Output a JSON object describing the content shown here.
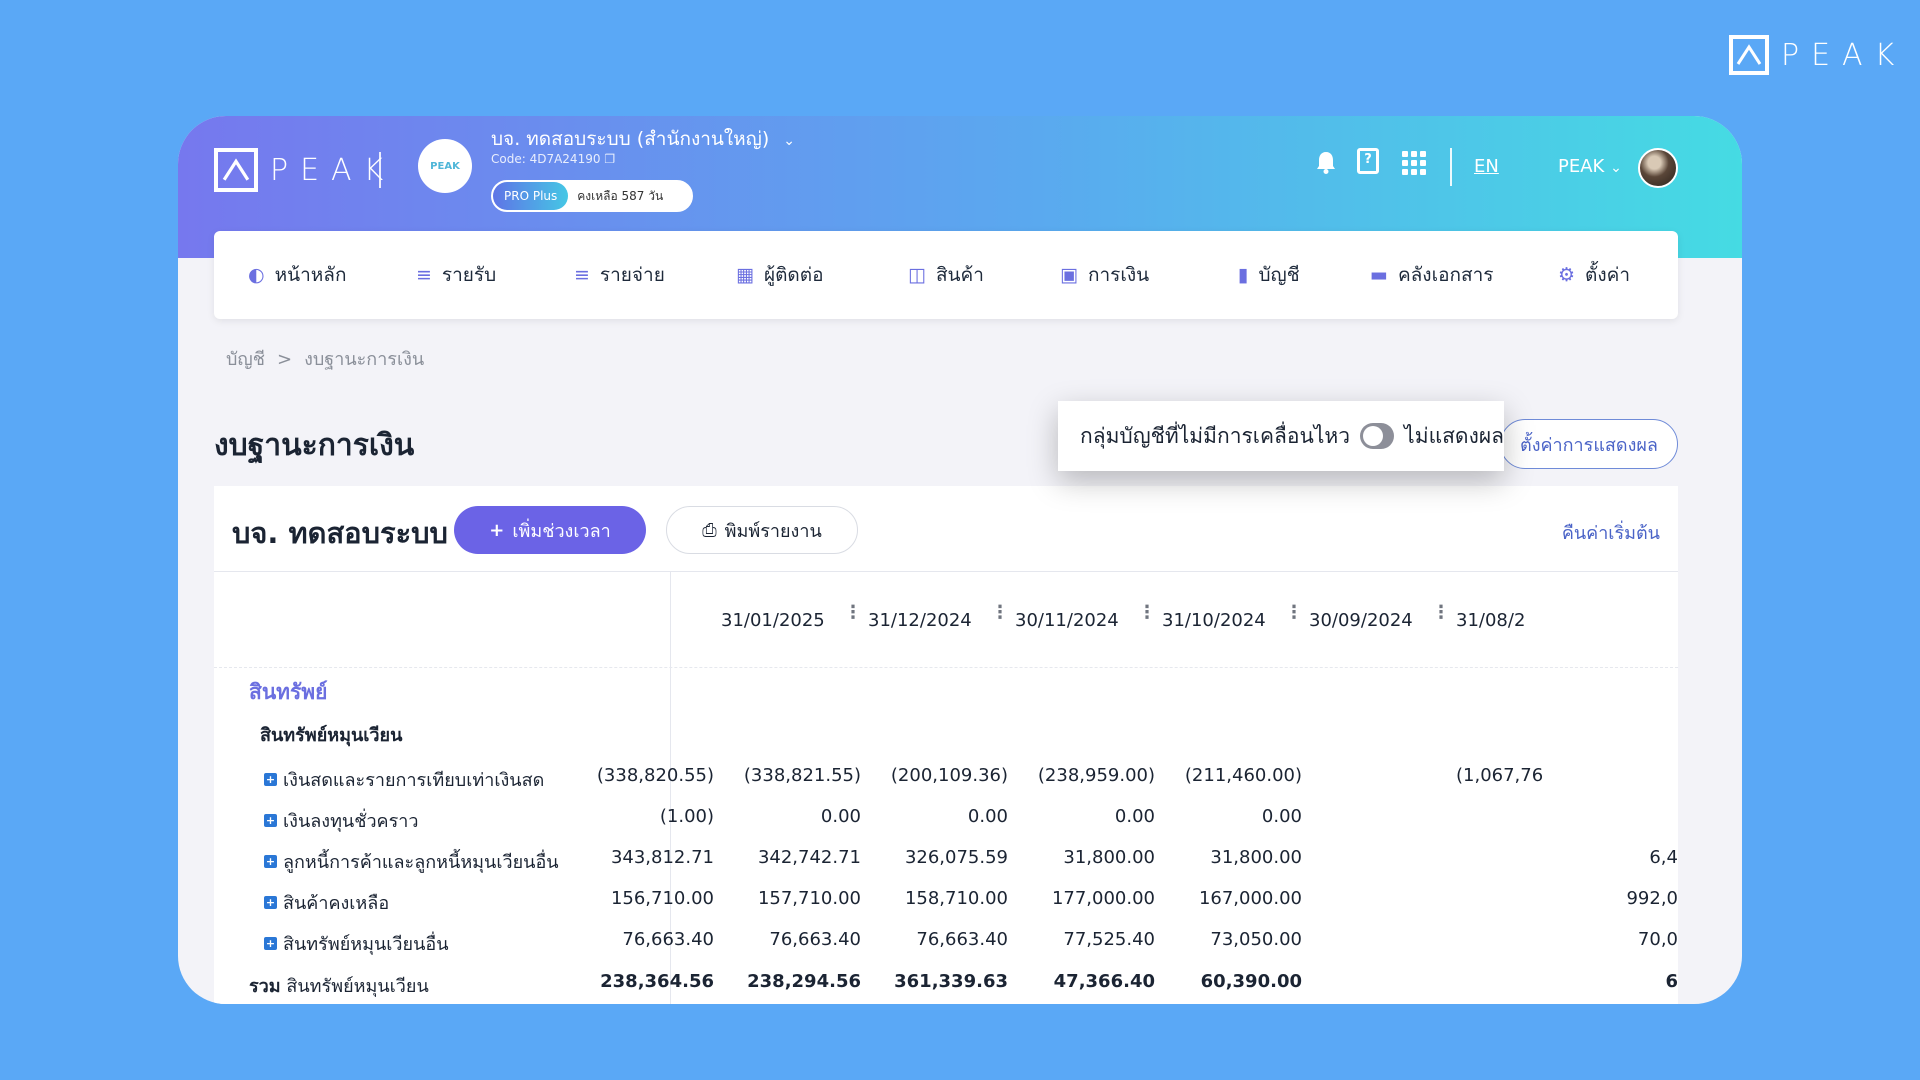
{
  "brand": {
    "name": "PEAK"
  },
  "header": {
    "company_name": "บจ. ทดสอบระบบ (สำนักงานใหญ่)",
    "company_code": "Code: 4D7A24190",
    "company_logo_text": "PEAK",
    "plan_name": "PRO Plus",
    "plan_remaining": "คงเหลือ 587 วัน",
    "lang": "EN",
    "user_name": "PEAK"
  },
  "nav": {
    "items": [
      {
        "label": "หน้าหลัก",
        "icon": "dashboard-icon"
      },
      {
        "label": "รายรับ",
        "icon": "income-list-icon"
      },
      {
        "label": "รายจ่าย",
        "icon": "expense-list-icon"
      },
      {
        "label": "ผู้ติดต่อ",
        "icon": "contacts-icon"
      },
      {
        "label": "สินค้า",
        "icon": "product-box-icon"
      },
      {
        "label": "การเงิน",
        "icon": "money-icon"
      },
      {
        "label": "บัญชี",
        "icon": "ledger-book-icon"
      },
      {
        "label": "คลังเอกสาร",
        "icon": "folder-icon"
      },
      {
        "label": "ตั้งค่า",
        "icon": "gear-icon"
      }
    ]
  },
  "breadcrumb": {
    "root": "บัญชี",
    "separator": ">",
    "current": "งบฐานะการเงิน"
  },
  "page": {
    "title": "งบฐานะการเงิน",
    "popover_label": "กลุ่มบัญชีที่ไม่มีการเคลื่อนไหว",
    "popover_toggle_state": "ไม่แสดงผล",
    "display_settings_button": "ตั้งค่าการแสดงผล"
  },
  "report": {
    "company": "บจ. ทดสอบระบบ",
    "add_period_button": "เพิ่มช่วงเวลา",
    "print_button": "พิมพ์รายงาน",
    "reset_link": "คืนค่าเริ่มต้น",
    "dates": [
      "31/01/2025",
      "31/12/2024",
      "30/11/2024",
      "31/10/2024",
      "30/09/2024",
      "31/08/2"
    ],
    "section": "สินทรัพย์",
    "subsection": "สินทรัพย์หมุนเวียน",
    "rows": [
      {
        "label": "เงินสดและรายการเทียบเท่าเงินสด",
        "values": [
          "(338,820.55)",
          "(338,821.55)",
          "(200,109.36)",
          "(238,959.00)",
          "(211,460.00)",
          "(1,067,76"
        ]
      },
      {
        "label": "เงินลงทุนชั่วคราว",
        "values": [
          "(1.00)",
          "0.00",
          "0.00",
          "0.00",
          "0.00",
          ""
        ]
      },
      {
        "label": "ลูกหนี้การค้าและลูกหนี้หมุนเวียนอื่น",
        "values": [
          "343,812.71",
          "342,742.71",
          "326,075.59",
          "31,800.00",
          "31,800.00",
          "6,4"
        ]
      },
      {
        "label": "สินค้าคงเหลือ",
        "values": [
          "156,710.00",
          "157,710.00",
          "158,710.00",
          "177,000.00",
          "167,000.00",
          "992,0"
        ]
      },
      {
        "label": "สินทรัพย์หมุนเวียนอื่น",
        "values": [
          "76,663.40",
          "76,663.40",
          "76,663.40",
          "77,525.40",
          "73,050.00",
          "70,0"
        ]
      }
    ],
    "total": {
      "prefix": "รวม",
      "label": "สินทรัพย์หมุนเวียน",
      "values": [
        "238,364.56",
        "238,294.56",
        "361,339.63",
        "47,366.40",
        "60,390.00",
        "6"
      ]
    }
  }
}
